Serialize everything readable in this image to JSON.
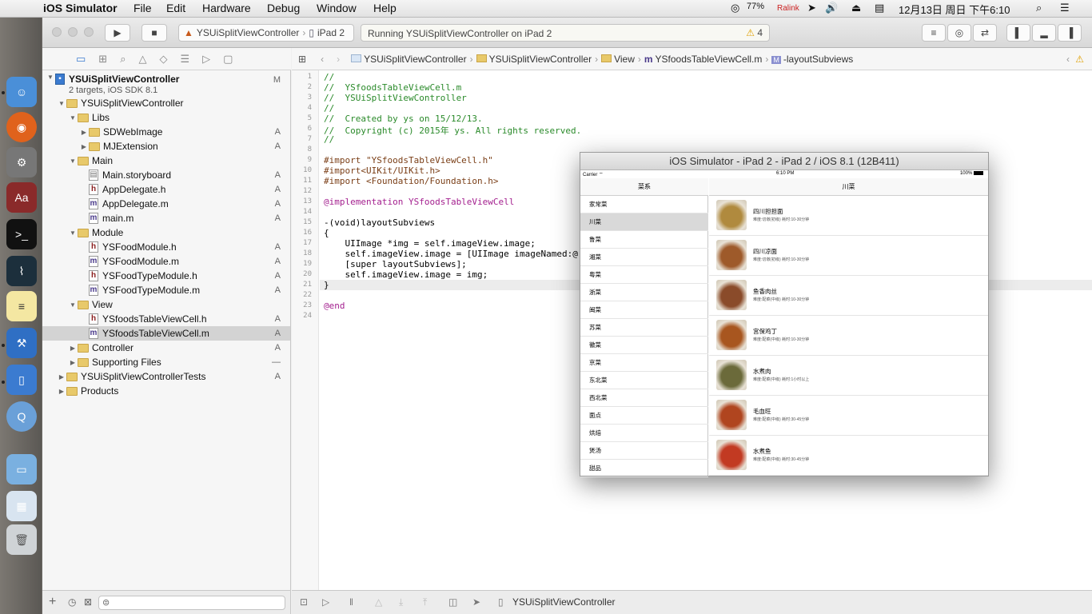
{
  "menubar": {
    "app": "iOS Simulator",
    "menus": [
      "File",
      "Edit",
      "Hardware",
      "Debug",
      "Window",
      "Help"
    ],
    "cpu": "77%",
    "ralink": "Ralink",
    "datetime": "12月13日 周日 下午6:10"
  },
  "toolbar": {
    "scheme_project": "YSUiSplitViewController",
    "scheme_device": "iPad 2",
    "activity": "Running YSUiSplitViewController on iPad 2",
    "warnings": "4"
  },
  "navigator": {
    "project": "YSUiSplitViewController",
    "project_sub": "2 targets, iOS SDK 8.1",
    "project_status": "M",
    "items": [
      {
        "label": "YSUiSplitViewController",
        "kind": "folder",
        "indent": 1,
        "open": true,
        "status": ""
      },
      {
        "label": "Libs",
        "kind": "folder",
        "indent": 2,
        "open": true,
        "status": ""
      },
      {
        "label": "SDWebImage",
        "kind": "folder",
        "indent": 3,
        "open": false,
        "status": "A"
      },
      {
        "label": "MJExtension",
        "kind": "folder",
        "indent": 3,
        "open": false,
        "status": "A"
      },
      {
        "label": "Main",
        "kind": "folder",
        "indent": 2,
        "open": true,
        "status": ""
      },
      {
        "label": "Main.storyboard",
        "kind": "sb",
        "indent": 3,
        "open": false,
        "status": "A"
      },
      {
        "label": "AppDelegate.h",
        "kind": "h",
        "indent": 3,
        "open": false,
        "status": "A"
      },
      {
        "label": "AppDelegate.m",
        "kind": "m",
        "indent": 3,
        "open": false,
        "status": "A"
      },
      {
        "label": "main.m",
        "kind": "m",
        "indent": 3,
        "open": false,
        "status": "A"
      },
      {
        "label": "Module",
        "kind": "folder",
        "indent": 2,
        "open": true,
        "status": ""
      },
      {
        "label": "YSFoodModule.h",
        "kind": "h",
        "indent": 3,
        "open": false,
        "status": "A"
      },
      {
        "label": "YSFoodModule.m",
        "kind": "m",
        "indent": 3,
        "open": false,
        "status": "A"
      },
      {
        "label": "YSFoodTypeModule.h",
        "kind": "h",
        "indent": 3,
        "open": false,
        "status": "A"
      },
      {
        "label": "YSFoodTypeModule.m",
        "kind": "m",
        "indent": 3,
        "open": false,
        "status": "A"
      },
      {
        "label": "View",
        "kind": "folder",
        "indent": 2,
        "open": true,
        "status": ""
      },
      {
        "label": "YSfoodsTableViewCell.h",
        "kind": "h",
        "indent": 3,
        "open": false,
        "status": "A"
      },
      {
        "label": "YSfoodsTableViewCell.m",
        "kind": "m",
        "indent": 3,
        "open": false,
        "status": "A",
        "selected": true
      },
      {
        "label": "Controller",
        "kind": "folder",
        "indent": 2,
        "open": false,
        "status": "A"
      },
      {
        "label": "Supporting Files",
        "kind": "folder",
        "indent": 2,
        "open": false,
        "status": "—"
      },
      {
        "label": "YSUiSplitViewControllerTests",
        "kind": "folder",
        "indent": 1,
        "open": false,
        "status": "A"
      },
      {
        "label": "Products",
        "kind": "folder",
        "indent": 1,
        "open": false,
        "status": ""
      }
    ]
  },
  "jumpbar": {
    "crumbs": [
      "YSUiSplitViewController",
      "YSUiSplitViewController",
      "View",
      "YSfoodsTableViewCell.m",
      "-layoutSubviews"
    ]
  },
  "editor": {
    "lines": [
      "//",
      "//  YSfoodsTableViewCell.m",
      "//  YSUiSplitViewController",
      "//",
      "//  Created by ys on 15/12/13.",
      "//  Copyright (c) 2015年 ys. All rights reserved.",
      "//",
      "",
      "#import \"YSfoodsTableViewCell.h\"",
      "#import<UIKit/UIKit.h>",
      "#import <Foundation/Foundation.h>",
      "",
      "@implementation YSfoodsTableViewCell",
      "",
      "-(void)layoutSubviews",
      "{",
      "    UIImage *img = self.imageView.image;",
      "    self.imageView.image = [UIImage imageNamed:@",
      "    [super layoutSubviews];",
      "    self.imageView.image = img;",
      "}",
      "",
      "@end",
      ""
    ]
  },
  "debugbar": {
    "target": "YSUiSplitViewController"
  },
  "simulator": {
    "title": "iOS Simulator - iPad 2 - iPad 2 / iOS 8.1 (12B411)",
    "carrier": "Carrier",
    "time": "6:10 PM",
    "battery": "100%",
    "master_title": "菜系",
    "categories": [
      "家常菜",
      "川菜",
      "鲁菜",
      "湘菜",
      "粤菜",
      "浙菜",
      "闽菜",
      "苏菜",
      "徽菜",
      "京菜",
      "东北菜",
      "西北菜",
      "面点",
      "烘焙",
      "煲汤",
      "甜品"
    ],
    "selected_category": 1,
    "detail_title": "川菜",
    "dishes": [
      {
        "name": "四川担担面",
        "desc": "难度:切墩(初级)  耗时:10-30分钟",
        "color": "#b08a3e"
      },
      {
        "name": "四川凉面",
        "desc": "难度:切墩(初级)  耗时:10-30分钟",
        "color": "#9e5a2a"
      },
      {
        "name": "鱼香肉丝",
        "desc": "难度:配菜(中级)  耗时:10-30分钟",
        "color": "#8a4b2a"
      },
      {
        "name": "宫保鸡丁",
        "desc": "难度:配菜(中级)  耗时:10-30分钟",
        "color": "#a8561f"
      },
      {
        "name": "水煮肉",
        "desc": "难度:配菜(中级)  耗时:1小时以上",
        "color": "#6b6a3a"
      },
      {
        "name": "毛血旺",
        "desc": "难度:配菜(中级)  耗时:30-45分钟",
        "color": "#b0451f"
      },
      {
        "name": "水煮鱼",
        "desc": "难度:配菜(中级)  耗时:30-45分钟",
        "color": "#c23a22"
      }
    ]
  }
}
